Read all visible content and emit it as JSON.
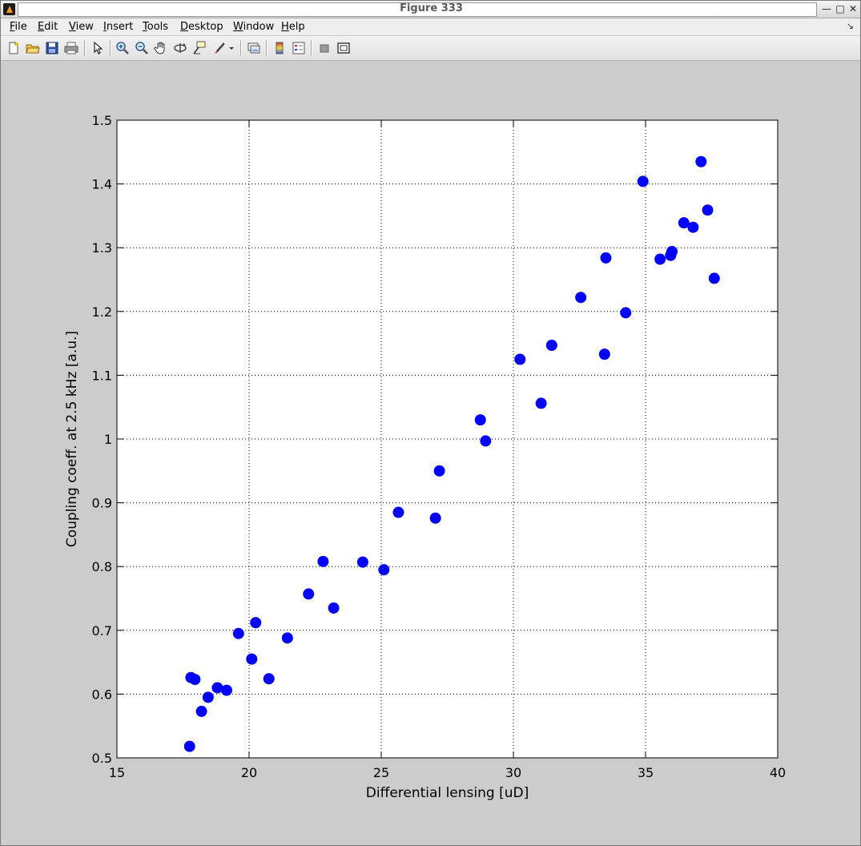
{
  "window": {
    "title": "Figure 333"
  },
  "window_buttons": {
    "minimize": "—",
    "maximize": "□",
    "close": "✕"
  },
  "menu": [
    {
      "pre": "",
      "u": "F",
      "post": "ile"
    },
    {
      "pre": "",
      "u": "E",
      "post": "dit"
    },
    {
      "pre": "",
      "u": "V",
      "post": "iew"
    },
    {
      "pre": "",
      "u": "I",
      "post": "nsert"
    },
    {
      "pre": "",
      "u": "T",
      "post": "ools"
    },
    {
      "pre": "",
      "u": "D",
      "post": "esktop"
    },
    {
      "pre": "",
      "u": "W",
      "post": "indow"
    },
    {
      "pre": "",
      "u": "H",
      "post": "elp"
    }
  ],
  "menu_extra": "↘",
  "toolbar_icons": [
    "new-figure-icon",
    "open-file-icon",
    "save-icon",
    "print-icon",
    "edit-plot-icon",
    "zoom-in-icon",
    "zoom-out-icon",
    "pan-icon",
    "rotate-3d-icon",
    "data-cursor-icon",
    "brush-icon",
    "brush-dropdown-icon",
    "link-plot-icon",
    "colorbar-icon",
    "legend-icon",
    "hide-plot-tools-icon",
    "show-plot-tools-icon"
  ],
  "colors": {
    "marker": "#0000ff",
    "axes_bg": "#ffffff",
    "figure_bg": "#cccccc"
  },
  "chart_data": {
    "type": "scatter",
    "title": "",
    "xlabel": "Differential lensing [uD]",
    "ylabel": "Coupling coeff. at 2.5 kHz [a.u.]",
    "xlim": [
      15,
      40
    ],
    "ylim": [
      0.5,
      1.5
    ],
    "xticks": [
      15,
      20,
      25,
      30,
      35,
      40
    ],
    "yticks": [
      0.5,
      0.6,
      0.7,
      0.8,
      0.9,
      1,
      1.1,
      1.2,
      1.3,
      1.4,
      1.5
    ],
    "grid": true,
    "legend": "none",
    "marker": "filled-circle",
    "points": [
      [
        17.75,
        0.518
      ],
      [
        17.8,
        0.626
      ],
      [
        17.95,
        0.623
      ],
      [
        18.2,
        0.573
      ],
      [
        18.45,
        0.595
      ],
      [
        18.8,
        0.61
      ],
      [
        19.15,
        0.606
      ],
      [
        19.6,
        0.695
      ],
      [
        20.1,
        0.655
      ],
      [
        20.25,
        0.712
      ],
      [
        20.75,
        0.624
      ],
      [
        21.45,
        0.688
      ],
      [
        22.25,
        0.757
      ],
      [
        22.8,
        0.808
      ],
      [
        23.2,
        0.735
      ],
      [
        24.3,
        0.807
      ],
      [
        25.1,
        0.795
      ],
      [
        25.65,
        0.885
      ],
      [
        27.05,
        0.876
      ],
      [
        27.2,
        0.95
      ],
      [
        28.75,
        1.03
      ],
      [
        28.95,
        0.997
      ],
      [
        30.25,
        1.125
      ],
      [
        31.05,
        1.056
      ],
      [
        31.45,
        1.147
      ],
      [
        32.55,
        1.222
      ],
      [
        33.45,
        1.133
      ],
      [
        33.5,
        1.284
      ],
      [
        34.25,
        1.198
      ],
      [
        34.9,
        1.404
      ],
      [
        35.55,
        1.282
      ],
      [
        35.95,
        1.288
      ],
      [
        36.0,
        1.294
      ],
      [
        36.45,
        1.339
      ],
      [
        36.8,
        1.332
      ],
      [
        37.1,
        1.435
      ],
      [
        37.35,
        1.359
      ],
      [
        37.6,
        1.252
      ]
    ]
  }
}
